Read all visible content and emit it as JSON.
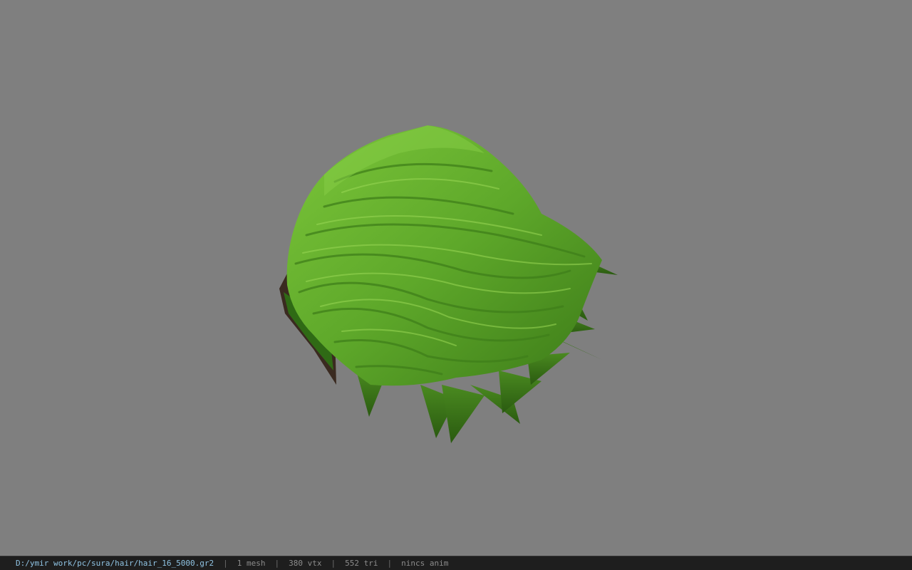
{
  "window": {
    "background_color": "#7f7f7f"
  },
  "model": {
    "name": "hair-mesh",
    "color": "#5ea82a"
  },
  "status_bar": {
    "file_path": "D:/ymir work/pc/sura/hair/hair_16_5000.gr2",
    "separator": "|",
    "mesh_count": "1 mesh",
    "vertex_count": "380 vtx",
    "triangle_count": "552 tri",
    "anim_info": "nincs anim"
  }
}
